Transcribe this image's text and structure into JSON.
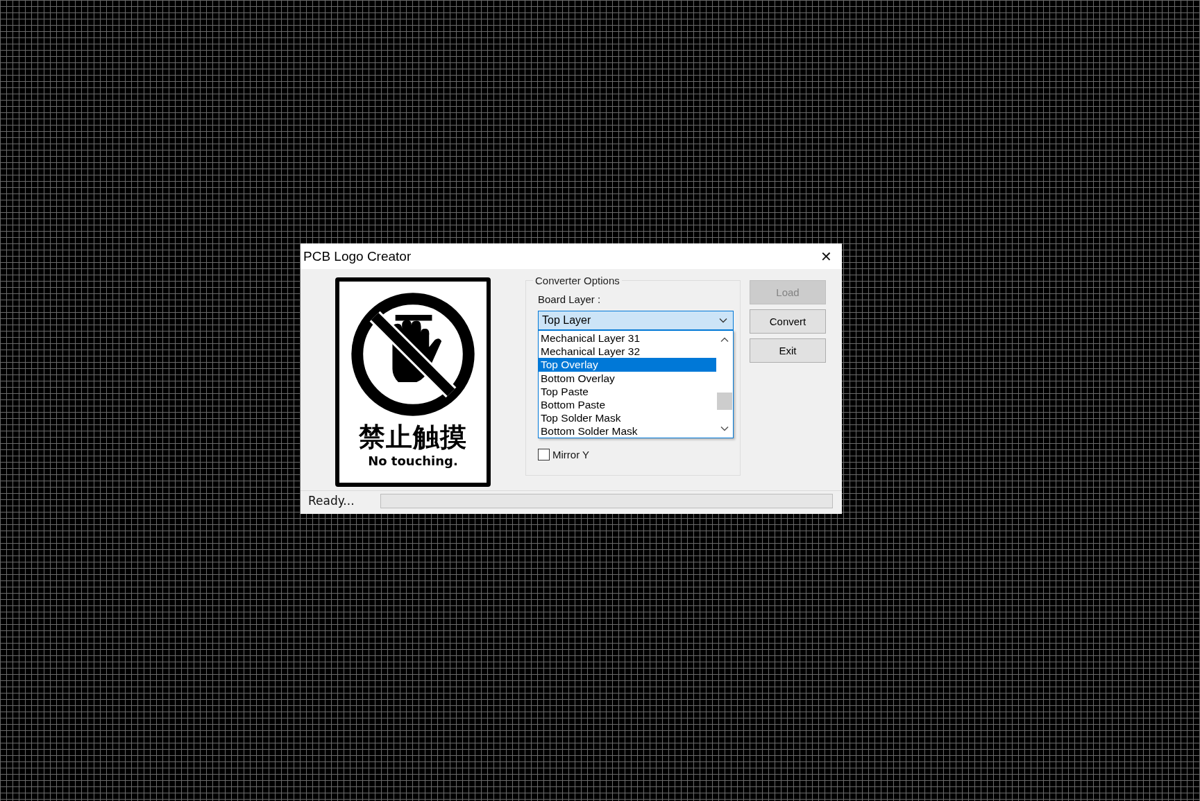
{
  "window": {
    "title": "PCB Logo Creator",
    "close": "✕"
  },
  "sign": {
    "chinese": "禁止触摸",
    "caption": "No touching."
  },
  "options": {
    "title": "Converter Options",
    "board_layer_label": "Board Layer :",
    "board_layer": {
      "value": "Top Layer",
      "expanded": true,
      "items": [
        {
          "label": "Mechanical Layer 31",
          "selected": false
        },
        {
          "label": "Mechanical Layer 32",
          "selected": false
        },
        {
          "label": "Top Overlay",
          "selected": true
        },
        {
          "label": "Bottom Overlay",
          "selected": false
        },
        {
          "label": "Top Paste",
          "selected": false
        },
        {
          "label": "Bottom Paste",
          "selected": false
        },
        {
          "label": "Top Solder Mask",
          "selected": false
        },
        {
          "label": "Bottom Solder Mask",
          "selected": false
        }
      ]
    },
    "checkboxes": [
      {
        "label": "Mirror Y",
        "checked": false
      }
    ]
  },
  "buttons": [
    {
      "label": "Load",
      "disabled": true
    },
    {
      "label": "Convert",
      "disabled": false
    },
    {
      "label": "Exit",
      "disabled": false
    }
  ],
  "status_bar": {
    "text": "Ready..."
  }
}
